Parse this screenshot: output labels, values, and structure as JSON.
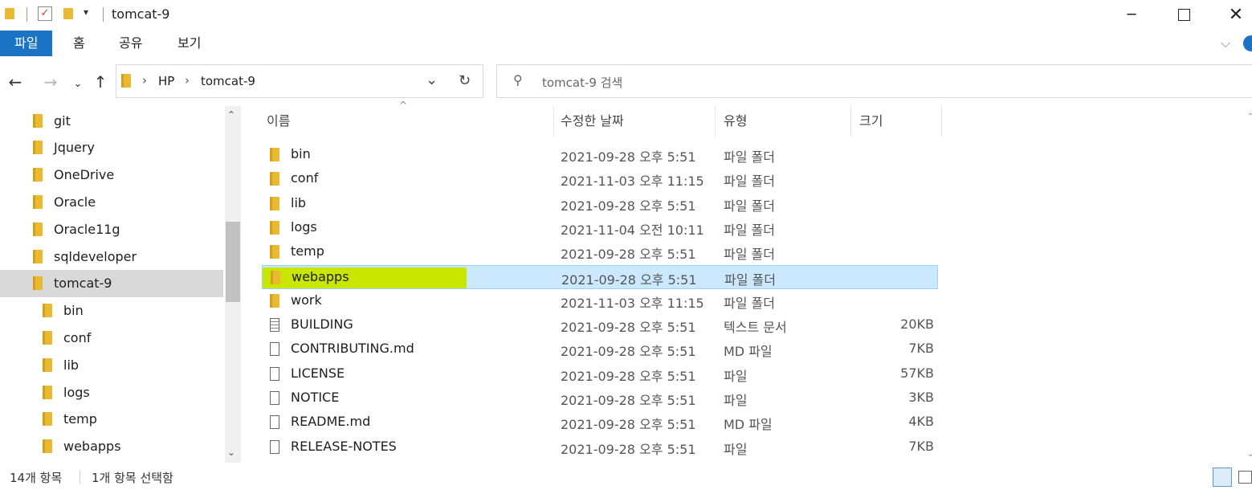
{
  "window": {
    "title": "tomcat-9"
  },
  "ribbon": {
    "tabs": [
      "파일",
      "홈",
      "공유",
      "보기"
    ]
  },
  "address": {
    "crumbs": [
      "HP",
      "tomcat-9"
    ]
  },
  "search": {
    "placeholder": "tomcat-9 검색"
  },
  "nav": {
    "items": [
      {
        "label": "git",
        "indent": false,
        "selected": false
      },
      {
        "label": "Jquery",
        "indent": false,
        "selected": false
      },
      {
        "label": "OneDrive",
        "indent": false,
        "selected": false
      },
      {
        "label": "Oracle",
        "indent": false,
        "selected": false
      },
      {
        "label": "Oracle11g",
        "indent": false,
        "selected": false
      },
      {
        "label": "sqldeveloper",
        "indent": false,
        "selected": false
      },
      {
        "label": "tomcat-9",
        "indent": false,
        "selected": true
      },
      {
        "label": "bin",
        "indent": true,
        "selected": false
      },
      {
        "label": "conf",
        "indent": true,
        "selected": false
      },
      {
        "label": "lib",
        "indent": true,
        "selected": false
      },
      {
        "label": "logs",
        "indent": true,
        "selected": false
      },
      {
        "label": "temp",
        "indent": true,
        "selected": false
      },
      {
        "label": "webapps",
        "indent": true,
        "selected": false
      }
    ]
  },
  "columns": {
    "name": "이름",
    "date": "수정한 날짜",
    "type": "유형",
    "size": "크기"
  },
  "files": [
    {
      "name": "bin",
      "date": "2021-09-28 오후 5:51",
      "type": "파일 폴더",
      "size": "",
      "kind": "folder"
    },
    {
      "name": "conf",
      "date": "2021-11-03 오후 11:15",
      "type": "파일 폴더",
      "size": "",
      "kind": "folder"
    },
    {
      "name": "lib",
      "date": "2021-09-28 오후 5:51",
      "type": "파일 폴더",
      "size": "",
      "kind": "folder"
    },
    {
      "name": "logs",
      "date": "2021-11-04 오전 10:11",
      "type": "파일 폴더",
      "size": "",
      "kind": "folder"
    },
    {
      "name": "temp",
      "date": "2021-09-28 오후 5:51",
      "type": "파일 폴더",
      "size": "",
      "kind": "folder"
    },
    {
      "name": "webapps",
      "date": "2021-09-28 오후 5:51",
      "type": "파일 폴더",
      "size": "",
      "kind": "folder",
      "selected": true
    },
    {
      "name": "work",
      "date": "2021-11-03 오후 11:15",
      "type": "파일 폴더",
      "size": "",
      "kind": "folder"
    },
    {
      "name": "BUILDING",
      "date": "2021-09-28 오후 5:51",
      "type": "텍스트 문서",
      "size": "20KB",
      "kind": "text"
    },
    {
      "name": "CONTRIBUTING.md",
      "date": "2021-09-28 오후 5:51",
      "type": "MD 파일",
      "size": "7KB",
      "kind": "file"
    },
    {
      "name": "LICENSE",
      "date": "2021-09-28 오후 5:51",
      "type": "파일",
      "size": "57KB",
      "kind": "file"
    },
    {
      "name": "NOTICE",
      "date": "2021-09-28 오후 5:51",
      "type": "파일",
      "size": "3KB",
      "kind": "file"
    },
    {
      "name": "README.md",
      "date": "2021-09-28 오후 5:51",
      "type": "MD 파일",
      "size": "4KB",
      "kind": "file"
    },
    {
      "name": "RELEASE-NOTES",
      "date": "2021-09-28 오후 5:51",
      "type": "파일",
      "size": "7KB",
      "kind": "file"
    }
  ],
  "status": {
    "count": "14개 항목",
    "selected": "1개 항목 선택함"
  },
  "colors": {
    "accent": "#1a73c5",
    "selection": "#cce8ff",
    "highlight": "#c8e600",
    "folder": "#e8b931"
  }
}
